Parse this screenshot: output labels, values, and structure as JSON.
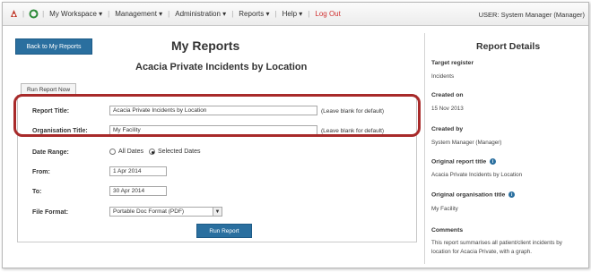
{
  "nav": {
    "items": [
      "My Workspace ▾",
      "Management ▾",
      "Administration ▾",
      "Reports ▾",
      "Help ▾"
    ],
    "logout": "Log Out",
    "user": "USER: System Manager (Manager)"
  },
  "main": {
    "back_button": "Back to My Reports",
    "title": "My Reports",
    "report_name": "Acacia Private Incidents by Location",
    "tab": "Run Report Now"
  },
  "form": {
    "report_title": {
      "label": "Report Title:",
      "value": "Acacia Private Incidents by Location",
      "hint": "(Leave blank for default)"
    },
    "org_title": {
      "label": "Organisation Title:",
      "value": "My Facility",
      "hint": "(Leave blank for default)"
    },
    "date_range": {
      "label": "Date Range:",
      "option_all": "All Dates",
      "option_selected": "Selected Dates",
      "selected": "Selected Dates"
    },
    "from": {
      "label": "From:",
      "value": "1 Apr 2014"
    },
    "to": {
      "label": "To:",
      "value": "30 Apr 2014"
    },
    "file_format": {
      "label": "File Format:",
      "value": "Portable Doc Format (PDF)"
    },
    "run_button": "Run Report"
  },
  "details": {
    "title": "Report Details",
    "target_register": {
      "label": "Target register",
      "value": "Incidents"
    },
    "created_on": {
      "label": "Created on",
      "value": "15 Nov 2013"
    },
    "created_by": {
      "label": "Created by",
      "value": "System Manager (Manager)"
    },
    "original_title": {
      "label": "Original report title",
      "value": "Acacia Private Incidents by Location"
    },
    "original_org": {
      "label": "Original organisation title",
      "value": "My Facility"
    },
    "comments": {
      "label": "Comments",
      "line1": "This report summarises all patient/client incidents by",
      "line2": "location for Acacia Private, with a graph."
    }
  },
  "colors": {
    "button": "#2a6f9f",
    "highlight": "#a82a2a",
    "logout": "#d03030"
  }
}
